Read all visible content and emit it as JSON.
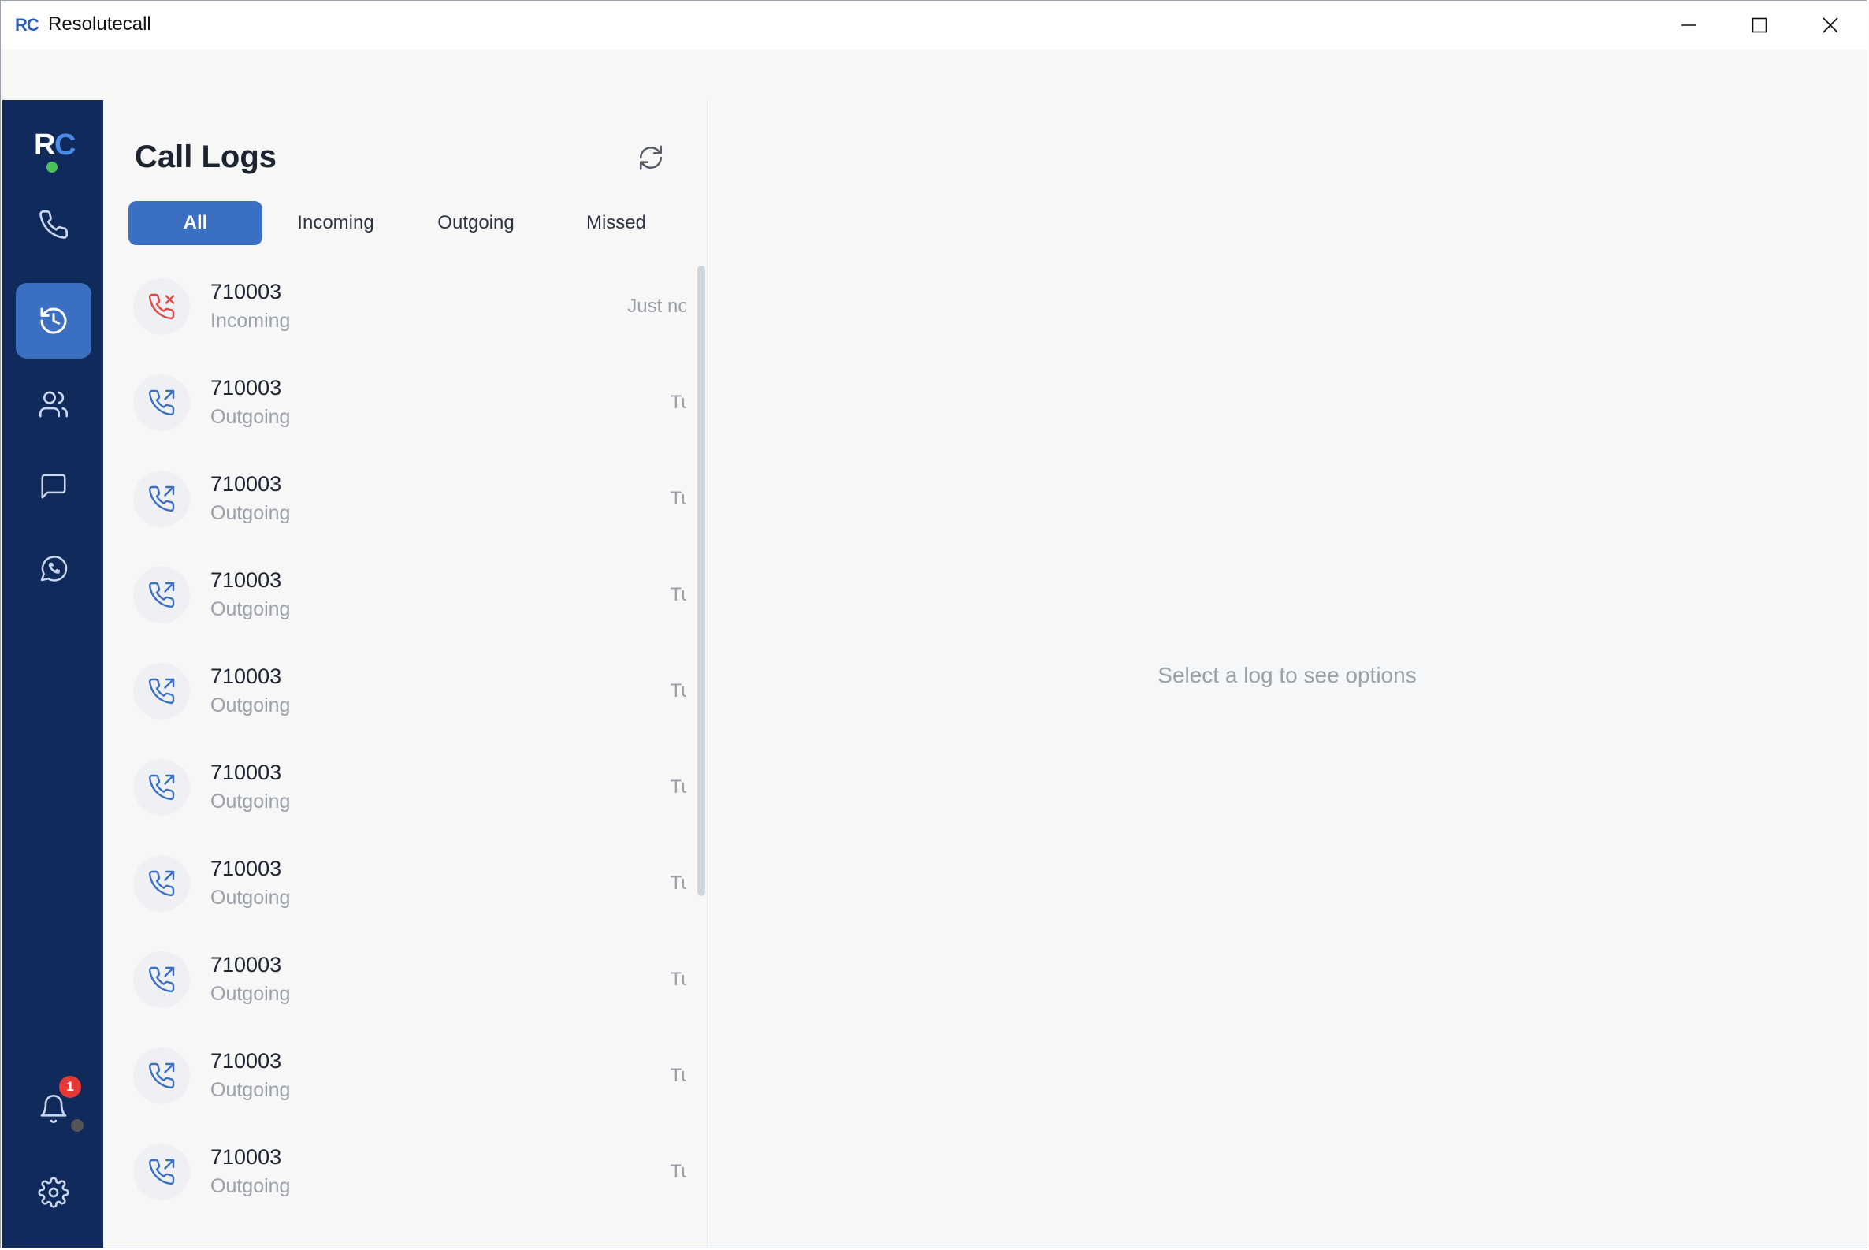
{
  "window": {
    "logo": "RC",
    "title": "Resolutecall"
  },
  "sidebar": {
    "logo_r": "R",
    "logo_c": "C",
    "items": [
      {
        "name": "phone",
        "icon": "phone-icon"
      },
      {
        "name": "history",
        "icon": "history-icon",
        "active": true
      },
      {
        "name": "contacts",
        "icon": "users-icon"
      },
      {
        "name": "messages",
        "icon": "message-icon"
      },
      {
        "name": "whatsapp",
        "icon": "whatsapp-icon"
      }
    ],
    "notifications_badge": "1"
  },
  "call_logs": {
    "title": "Call Logs",
    "tabs": [
      {
        "label": "All",
        "active": true
      },
      {
        "label": "Incoming"
      },
      {
        "label": "Outgoing"
      },
      {
        "label": "Missed"
      }
    ],
    "entries": [
      {
        "number": "710003",
        "type": "Incoming",
        "time": "Just now",
        "status": "missed"
      },
      {
        "number": "710003",
        "type": "Outgoing",
        "time": "Tue",
        "status": "outgoing"
      },
      {
        "number": "710003",
        "type": "Outgoing",
        "time": "Tue",
        "status": "outgoing"
      },
      {
        "number": "710003",
        "type": "Outgoing",
        "time": "Tue",
        "status": "outgoing"
      },
      {
        "number": "710003",
        "type": "Outgoing",
        "time": "Tue",
        "status": "outgoing"
      },
      {
        "number": "710003",
        "type": "Outgoing",
        "time": "Tue",
        "status": "outgoing"
      },
      {
        "number": "710003",
        "type": "Outgoing",
        "time": "Tue",
        "status": "outgoing"
      },
      {
        "number": "710003",
        "type": "Outgoing",
        "time": "Tue",
        "status": "outgoing"
      },
      {
        "number": "710003",
        "type": "Outgoing",
        "time": "Tue",
        "status": "outgoing"
      },
      {
        "number": "710003",
        "type": "Outgoing",
        "time": "Tue",
        "status": "outgoing"
      }
    ]
  },
  "detail": {
    "empty_message": "Select a log to see options"
  },
  "colors": {
    "sidebar_bg": "#102a5c",
    "accent": "#3a6fc2",
    "missed_red": "#e04848",
    "badge_red": "#e53935",
    "online_green": "#4cc35a"
  }
}
